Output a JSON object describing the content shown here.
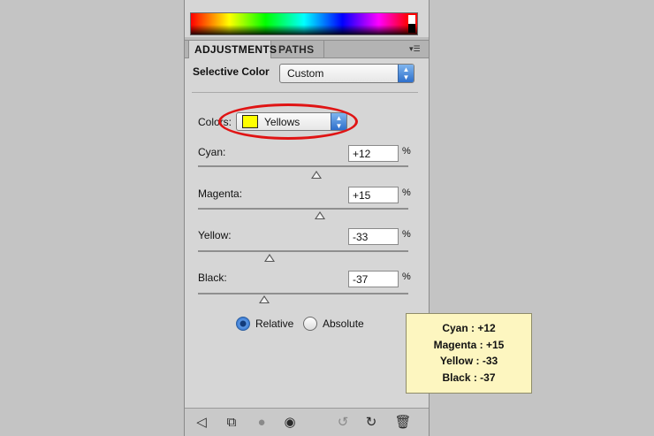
{
  "tabs": {
    "adjustments": "ADJUSTMENTS",
    "paths": "PATHS"
  },
  "panel_menu_icon": "panel-menu-icon",
  "header": {
    "title": "Selective Color",
    "preset_value": "Custom"
  },
  "colors": {
    "label": "Colors:",
    "value": "Yellows",
    "swatch_color": "#ffff00"
  },
  "sliders": [
    {
      "label": "Cyan:",
      "value": "+12",
      "unit": "%",
      "numeric": 12
    },
    {
      "label": "Magenta:",
      "value": "+15",
      "unit": "%",
      "numeric": 15
    },
    {
      "label": "Yellow:",
      "value": "-33",
      "unit": "%",
      "numeric": -33
    },
    {
      "label": "Black:",
      "value": "-37",
      "unit": "%",
      "numeric": -37
    }
  ],
  "method": {
    "relative_label": "Relative",
    "absolute_label": "Absolute",
    "selected": "Relative"
  },
  "toolbar_icons": [
    "back-arrow-icon",
    "clip-to-layer-icon",
    "visibility-mask-icon",
    "eye-icon",
    "view-previous-state-icon",
    "reset-icon",
    "trash-icon"
  ],
  "annotation": {
    "lines": [
      "Cyan : +12",
      "Magenta : +15",
      "Yellow : -33",
      "Black : -37"
    ],
    "highlight_color": "#e01414"
  },
  "colors_theme": {
    "accent": "#2e6fcb",
    "note_bg": "#fdf6c0"
  }
}
